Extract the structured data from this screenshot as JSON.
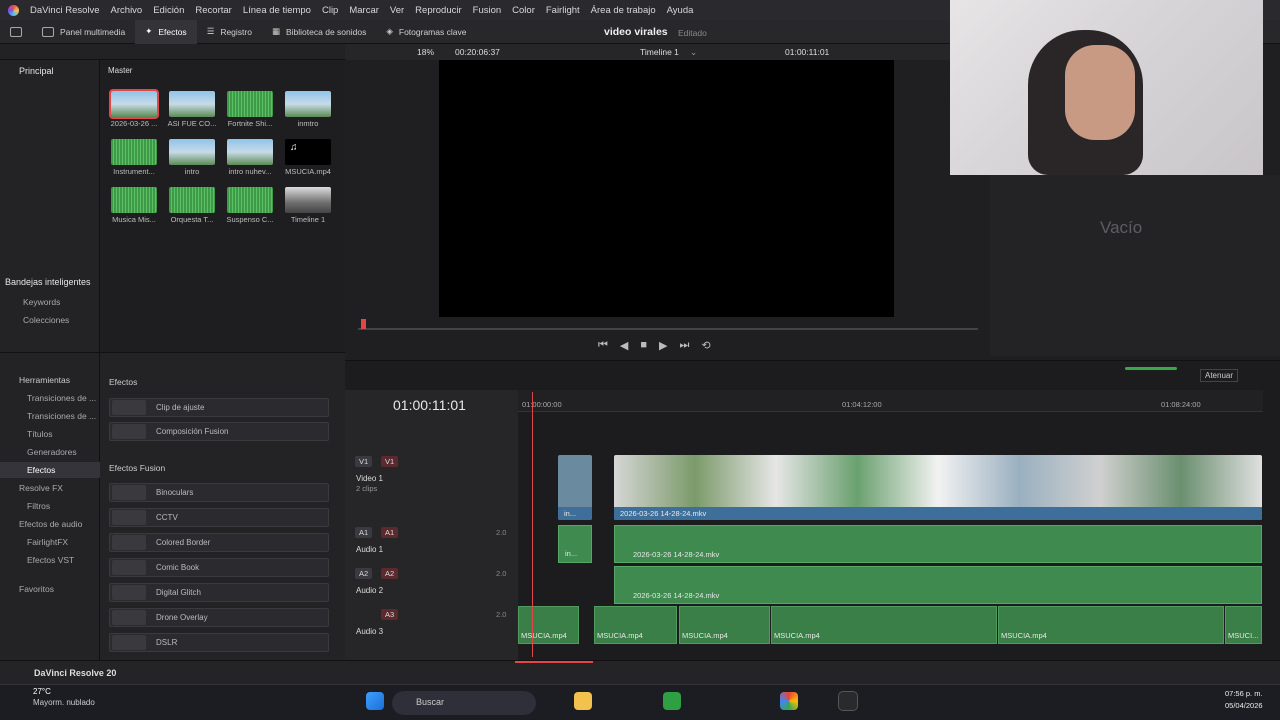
{
  "menu": {
    "app": "DaVinci Resolve",
    "items": [
      "Archivo",
      "Edición",
      "Recortar",
      "Línea de tiempo",
      "Clip",
      "Marcar",
      "Ver",
      "Reproducir",
      "Fusion",
      "Color",
      "Fairlight",
      "Área de trabajo",
      "Ayuda"
    ]
  },
  "toolbar": {
    "media_pool": "Panel multimedia",
    "effects": "Efectos",
    "log": "Registro",
    "sound_library": "Biblioteca de sonidos",
    "keyframes": "Fotogramas clave",
    "project_name": "video virales",
    "status": "Editado"
  },
  "viewer": {
    "zoom": "18%",
    "source_tc": "00:20:06:37",
    "timeline_name": "Timeline 1",
    "record_tc": "01:00:11:01"
  },
  "bins": {
    "main": "Principal",
    "master": "Master",
    "smart_bins": "Bandejas inteligentes",
    "smart": [
      "Keywords",
      "Colecciones"
    ]
  },
  "media": [
    {
      "name": "2026-03-26 ...",
      "kind": "img",
      "selected": true
    },
    {
      "name": "ASI FUE CO...",
      "kind": "img"
    },
    {
      "name": "Fortnite Shi...",
      "kind": "wave"
    },
    {
      "name": "inmtro",
      "kind": "img"
    },
    {
      "name": "Instrument...",
      "kind": "wave"
    },
    {
      "name": "intro",
      "kind": "img"
    },
    {
      "name": "intro nuhev...",
      "kind": "img"
    },
    {
      "name": "MSUCIA.mp4",
      "kind": "blk"
    },
    {
      "name": "Musica Mis...",
      "kind": "wave"
    },
    {
      "name": "Orquesta T...",
      "kind": "wave"
    },
    {
      "name": "Suspenso C...",
      "kind": "wave"
    },
    {
      "name": "Timeline 1",
      "kind": "tl"
    }
  ],
  "right_panel": {
    "empty_label": "Vacío"
  },
  "effects_tree": {
    "tools": "Herramientas",
    "items": [
      "Transiciones de ...",
      "Transiciones de ...",
      "Títulos",
      "Generadores",
      "Efectos"
    ],
    "resolve_fx": "Resolve FX",
    "filters": "Filtros",
    "audio_effects": "Efectos de audio",
    "fairlight_fx": "FairlightFX",
    "vst": "Efectos VST",
    "favorites": "Favoritos"
  },
  "effects_list": {
    "section1": "Efectos",
    "items1": [
      "Clip de ajuste",
      "Composición Fusion"
    ],
    "section2": "Efectos Fusion",
    "items2": [
      "Binoculars",
      "CCTV",
      "Colored Border",
      "Comic Book",
      "Digital Glitch",
      "Drone Overlay",
      "DSLR"
    ]
  },
  "timeline": {
    "timecode": "01:00:11:01",
    "ruler": [
      "01:00:00:00",
      "01:04:12:00",
      "01:08:24:00"
    ],
    "attenuate": "Atenuar",
    "tracks": {
      "v1": {
        "tag": "V1",
        "name": "Video 1",
        "clips": "2 clips"
      },
      "a1": {
        "tag": "A1",
        "name": "Audio 1",
        "level": "2.0"
      },
      "a2": {
        "tag": "A2",
        "name": "Audio 2",
        "level": "2.0"
      },
      "a3": {
        "tag": "A3",
        "name": "Audio 3",
        "level": "2.0"
      }
    },
    "video_clip": "2026-03-26 14-28-24.mkv",
    "intro_clip": "in...",
    "a1_clip": "2026-03-26 14-28-24.mkv",
    "a2_clip": "2026-03-26 14-28-24.mkv",
    "a3_clip": "MSUCIA.mp4",
    "a3_last": "MSUCI..."
  },
  "footer": {
    "brand": "DaVinci Resolve 20"
  },
  "taskbar": {
    "temp": "27°C",
    "weather": "Mayorm. nublado",
    "search": "Buscar",
    "time": "07:56 p. m.",
    "date": "05/04/2026"
  },
  "colors": {
    "accent_red": "#e0464a",
    "video_blue": "#3e6f9a",
    "audio_green": "#3e8a4f"
  }
}
